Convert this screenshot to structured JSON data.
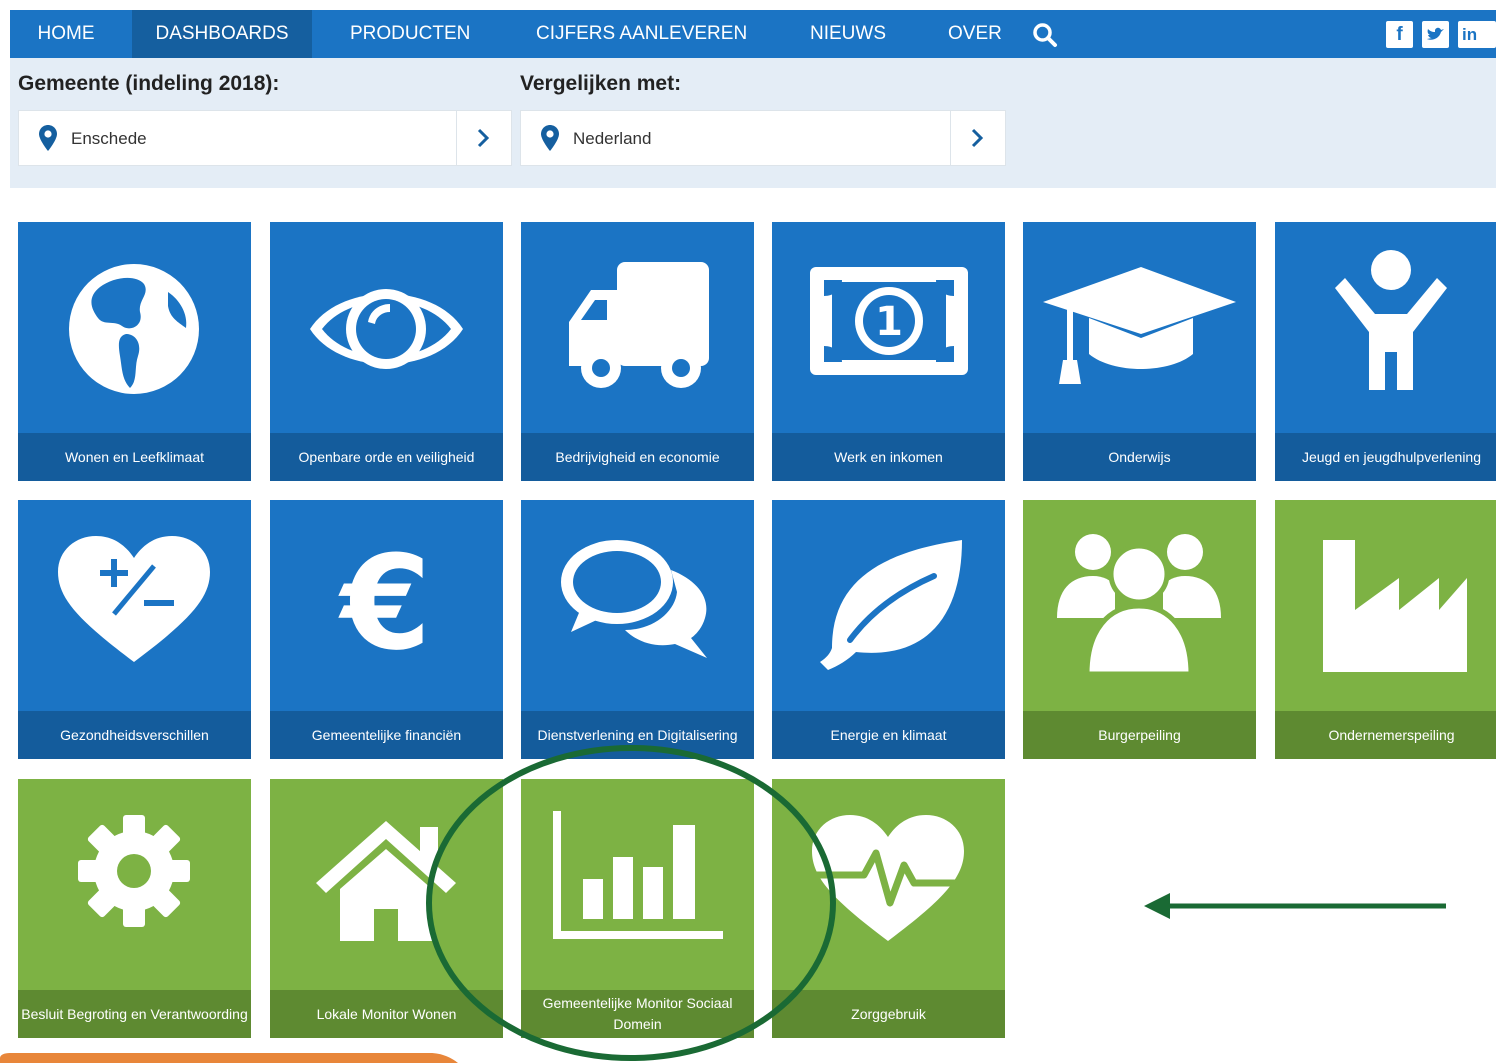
{
  "nav": {
    "items": [
      "HOME",
      "DASHBOARDS",
      "PRODUCTEN",
      "CIJFERS AANLEVEREN",
      "NIEUWS",
      "OVER"
    ],
    "active": "DASHBOARDS",
    "search_icon": "search-icon",
    "social": [
      "facebook-icon",
      "twitter-icon",
      "linkedin-icon"
    ]
  },
  "selectors": {
    "gemeente_label": "Gemeente (indeling 2018):",
    "gemeente_value": "Enschede",
    "compare_label": "Vergelijken met:",
    "compare_value": "Nederland"
  },
  "tiles": [
    {
      "label": "Wonen en Leefklimaat",
      "icon": "globe-icon",
      "color": "blue"
    },
    {
      "label": "Openbare orde en veiligheid",
      "icon": "eye-icon",
      "color": "blue"
    },
    {
      "label": "Bedrijvigheid en economie",
      "icon": "truck-icon",
      "color": "blue"
    },
    {
      "label": "Werk en inkomen",
      "icon": "banknote-icon",
      "color": "blue"
    },
    {
      "label": "Onderwijs",
      "icon": "graduation-cap-icon",
      "color": "blue"
    },
    {
      "label": "Jeugd en jeugdhulpverlening",
      "icon": "child-icon",
      "color": "blue"
    },
    {
      "label": "Gezondheidsverschillen",
      "icon": "heart-plus-minus-icon",
      "color": "blue"
    },
    {
      "label": "Gemeentelijke financiën",
      "icon": "euro-icon",
      "color": "blue"
    },
    {
      "label": "Dienstverlening en Digitalisering",
      "icon": "chat-bubbles-icon",
      "color": "blue"
    },
    {
      "label": "Energie en klimaat",
      "icon": "leaf-icon",
      "color": "blue"
    },
    {
      "label": "Burgerpeiling",
      "icon": "people-group-icon",
      "color": "green"
    },
    {
      "label": "Ondernemerspeiling",
      "icon": "factory-icon",
      "color": "green"
    },
    {
      "label": "Besluit Begroting en Verantwoording",
      "icon": "gear-icon",
      "color": "green"
    },
    {
      "label": "Lokale Monitor Wonen",
      "icon": "house-icon",
      "color": "green"
    },
    {
      "label": "Gemeentelijke Monitor Sociaal Domein",
      "icon": "bar-chart-icon",
      "color": "green"
    },
    {
      "label": "Zorggebruik",
      "icon": "heartbeat-icon",
      "color": "green"
    }
  ],
  "colors": {
    "nav_blue": "#1b74c4",
    "tile_blue": "#1b74c4",
    "tile_green": "#7db244",
    "annotation_green": "#1a6a34",
    "bottom_orange": "#e8863a"
  },
  "annotations": {
    "highlight_circle_target": "Gemeentelijke Monitor Sociaal Domein",
    "arrow_direction": "left"
  }
}
